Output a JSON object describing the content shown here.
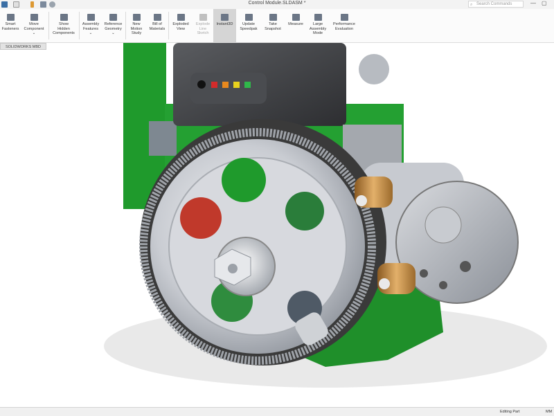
{
  "window": {
    "title": "Control Module.SLDASM *",
    "search_placeholder": "Search Commands",
    "minimize": "—",
    "maximize": "▢"
  },
  "ribbon": {
    "buttons": [
      {
        "label": "Smart\nFasteners"
      },
      {
        "label": "Move\nComponent\n⌄"
      },
      {
        "label": "Show\nHidden\nComponents"
      },
      {
        "label": "Assembly\nFeatures\n⌄"
      },
      {
        "label": "Reference\nGeometry\n⌄"
      },
      {
        "label": "New\nMotion\nStudy"
      },
      {
        "label": "Bill of\nMaterials"
      },
      {
        "label": "Exploded\nView"
      },
      {
        "label": "Explode\nLine\nSketch"
      },
      {
        "label": "Instant3D"
      },
      {
        "label": "Update\nSpeedpak"
      },
      {
        "label": "Take\nSnapshot"
      },
      {
        "label": "Measure"
      },
      {
        "label": "Large\nAssembly\nMode"
      },
      {
        "label": "Performance\nEvaluation"
      }
    ]
  },
  "tabs": {
    "active": "SOLIDWORKS MBD"
  },
  "status": {
    "mode": "Editing Part",
    "units": "MM"
  },
  "colors": {
    "pcb": "#1f9a2c",
    "gear": "#c6c9cf",
    "belt": "#3a3a3a",
    "bronze": "#c68a3f"
  }
}
